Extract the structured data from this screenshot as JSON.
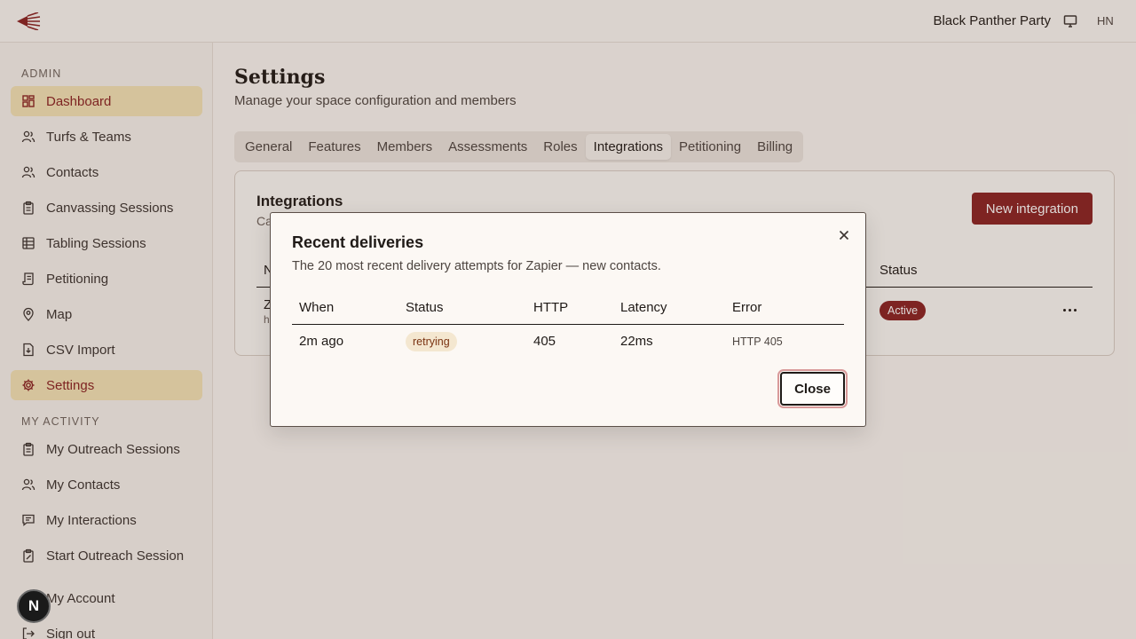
{
  "topbar": {
    "org_name": "Black Panther Party",
    "user_initials": "HN",
    "icons": {
      "logo": "megaphone-logo",
      "display": "monitor-icon"
    }
  },
  "sidebar": {
    "admin_label": "ADMIN",
    "activity_label": "MY ACTIVITY",
    "admin_items": [
      {
        "label": "Dashboard",
        "icon": "dashboard-icon",
        "active": true
      },
      {
        "label": "Turfs & Teams",
        "icon": "users-icon"
      },
      {
        "label": "Contacts",
        "icon": "contacts-icon"
      },
      {
        "label": "Canvassing Sessions",
        "icon": "clipboard-icon"
      },
      {
        "label": "Tabling Sessions",
        "icon": "table-icon"
      },
      {
        "label": "Petitioning",
        "icon": "scroll-icon"
      },
      {
        "label": "Map",
        "icon": "map-pin-icon"
      },
      {
        "label": "CSV Import",
        "icon": "file-import-icon"
      },
      {
        "label": "Settings",
        "icon": "gear-icon",
        "active": true
      }
    ],
    "activity_items": [
      {
        "label": "My Outreach Sessions",
        "icon": "clipboard-icon"
      },
      {
        "label": "My Contacts",
        "icon": "users-icon"
      },
      {
        "label": "My Interactions",
        "icon": "message-icon"
      },
      {
        "label": "Start Outreach Session",
        "icon": "clipboard-edit-icon"
      },
      {
        "label": "My Account",
        "icon": "user-icon"
      },
      {
        "label": "Sign out",
        "icon": "sign-out-icon"
      }
    ]
  },
  "main": {
    "title": "Settings",
    "subtitle": "Manage your space configuration and members",
    "tabs": [
      "General",
      "Features",
      "Members",
      "Assessments",
      "Roles",
      "Integrations",
      "Petitioning",
      "Billing"
    ],
    "active_tab": "Integrations"
  },
  "integrations_card": {
    "title": "Integrations",
    "desc_visible": "Ca",
    "new_button": "New integration",
    "col_name_visible": "N",
    "col_status": "Status",
    "row_name_visible": "Z",
    "row_sub_visible": "h",
    "row_status": "Active",
    "more_icon": "more-horizontal-icon"
  },
  "modal": {
    "title": "Recent deliveries",
    "description": "The 20 most recent delivery attempts for Zapier — new contacts.",
    "columns": [
      "When",
      "Status",
      "HTTP",
      "Latency",
      "Error"
    ],
    "rows": [
      {
        "when": "2m ago",
        "status": "retrying",
        "http": "405",
        "latency": "22ms",
        "error": "HTTP 405"
      }
    ],
    "close_button": "Close",
    "close_icon": "close-icon"
  },
  "dev_badge": {
    "letter": "N"
  },
  "colors": {
    "accent": "#8a2323",
    "active_nav_bg": "#f4e4b8",
    "page_bg": "#faf7f3"
  }
}
